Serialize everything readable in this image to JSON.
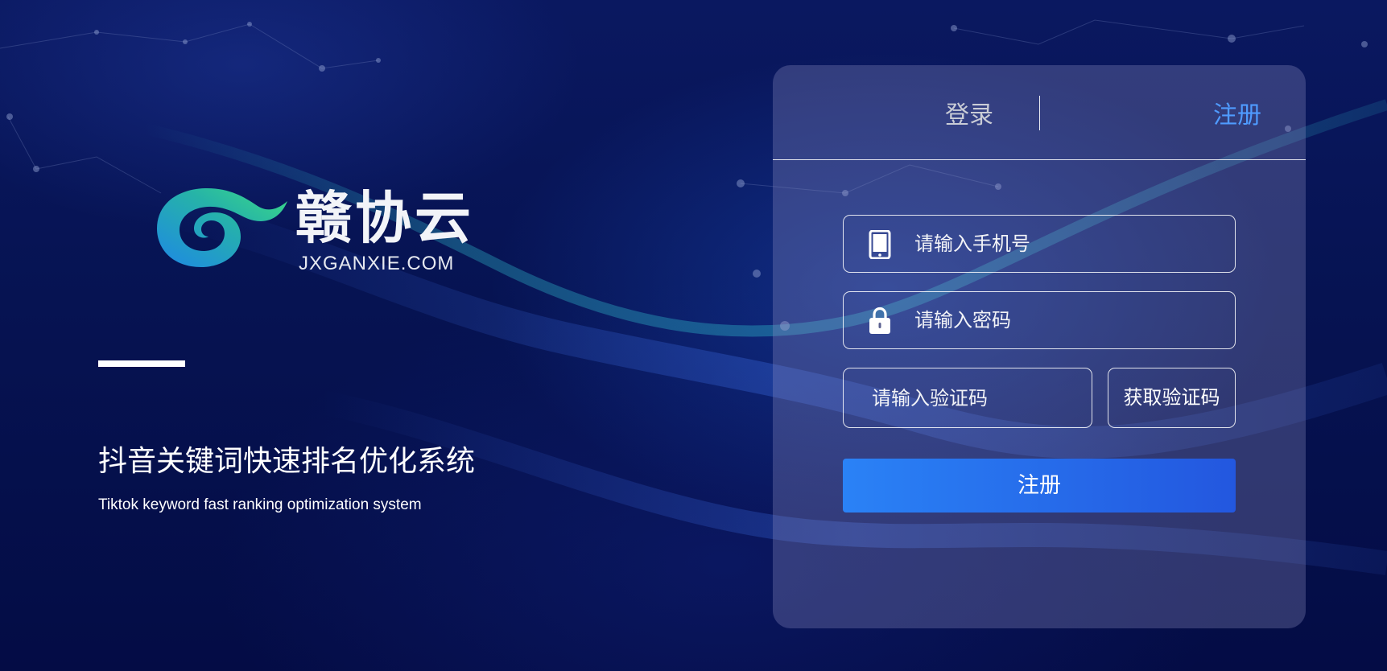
{
  "brand": {
    "name": "赣协云",
    "domain": "JXGANXIE.COM"
  },
  "hero": {
    "title": "抖音关键词快速排名优化系统",
    "subtitle": "Tiktok keyword fast ranking optimization system"
  },
  "auth": {
    "tabs": [
      {
        "label": "登录",
        "active": false
      },
      {
        "label": "注册",
        "active": true
      }
    ],
    "phone_placeholder": "请输入手机号",
    "password_placeholder": "请输入密码",
    "code_placeholder": "请输入验证码",
    "get_code_label": "获取验证码",
    "submit_label": "注册"
  },
  "icons": {
    "phone": "phone-icon",
    "lock": "lock-icon"
  },
  "colors": {
    "active_tab": "#4f9bff",
    "inactive_tab": "#c9ccd6",
    "button_start": "#2a82f6",
    "button_end": "#2357df",
    "background": "#061352"
  }
}
